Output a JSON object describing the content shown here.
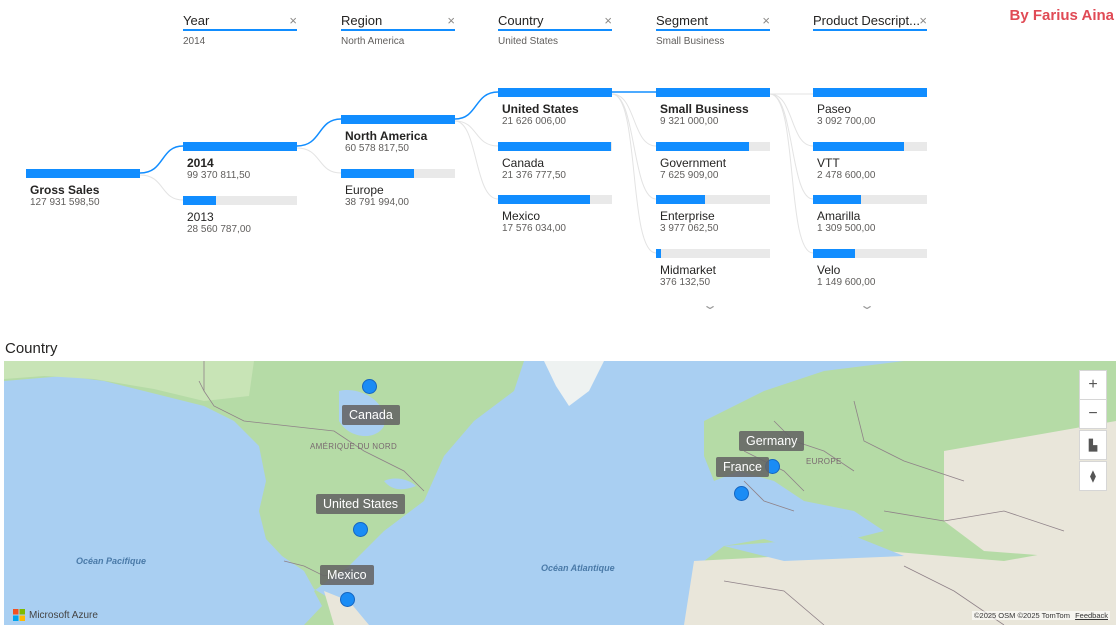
{
  "credit": "By Farius Aina",
  "tree": {
    "levels": [
      {
        "title": "Year",
        "filter": "2014"
      },
      {
        "title": "Region",
        "filter": "North America"
      },
      {
        "title": "Country",
        "filter": "United States"
      },
      {
        "title": "Segment",
        "filter": "Small Business"
      },
      {
        "title": "Product Descript...",
        "filter": ""
      }
    ],
    "root": {
      "label": "Gross Sales",
      "value": "127 931 598,50"
    },
    "year": [
      {
        "label": "2014",
        "value": "99 370 811,50",
        "fraction": 1.0
      },
      {
        "label": "2013",
        "value": "28 560 787,00",
        "fraction": 0.29
      }
    ],
    "region": [
      {
        "label": "North America",
        "value": "60 578 817,50",
        "fraction": 1.0
      },
      {
        "label": "Europe",
        "value": "38 791 994,00",
        "fraction": 0.64
      }
    ],
    "country": [
      {
        "label": "United States",
        "value": "21 626 006,00",
        "fraction": 1.0
      },
      {
        "label": "Canada",
        "value": "21 376 777,50",
        "fraction": 0.99
      },
      {
        "label": "Mexico",
        "value": "17 576 034,00",
        "fraction": 0.81
      }
    ],
    "segment": [
      {
        "label": "Small Business",
        "value": "9 321 000,00",
        "fraction": 1.0
      },
      {
        "label": "Government",
        "value": "7 625 909,00",
        "fraction": 0.82
      },
      {
        "label": "Enterprise",
        "value": "3 977 062,50",
        "fraction": 0.43
      },
      {
        "label": "Midmarket",
        "value": "376 132,50",
        "fraction": 0.04
      }
    ],
    "product": [
      {
        "label": "Paseo",
        "value": "3 092 700,00",
        "fraction": 1.0
      },
      {
        "label": "VTT",
        "value": "2 478 600,00",
        "fraction": 0.8
      },
      {
        "label": "Amarilla",
        "value": "1 309 500,00",
        "fraction": 0.42
      },
      {
        "label": "Velo",
        "value": "1 149 600,00",
        "fraction": 0.37
      }
    ]
  },
  "map": {
    "title": "Country",
    "labels": {
      "canada": "Canada",
      "united_states": "United States",
      "mexico": "Mexico",
      "germany": "Germany",
      "france": "France"
    },
    "regions": {
      "north_america": "AMÉRIQUE DU NORD",
      "europe": "EUROPE"
    },
    "oceans": {
      "pacific": "Océan Pacifique",
      "atlantic": "Océan Atlantique"
    },
    "branding": "Microsoft Azure",
    "attribution": "©2025 OSM  ©2025 TomTom",
    "feedback": "Feedback",
    "colors": {
      "bubble": "#1a8cf5",
      "water": "#a9cff2",
      "land": "#b7dca8",
      "bar": "#118DFF"
    }
  }
}
